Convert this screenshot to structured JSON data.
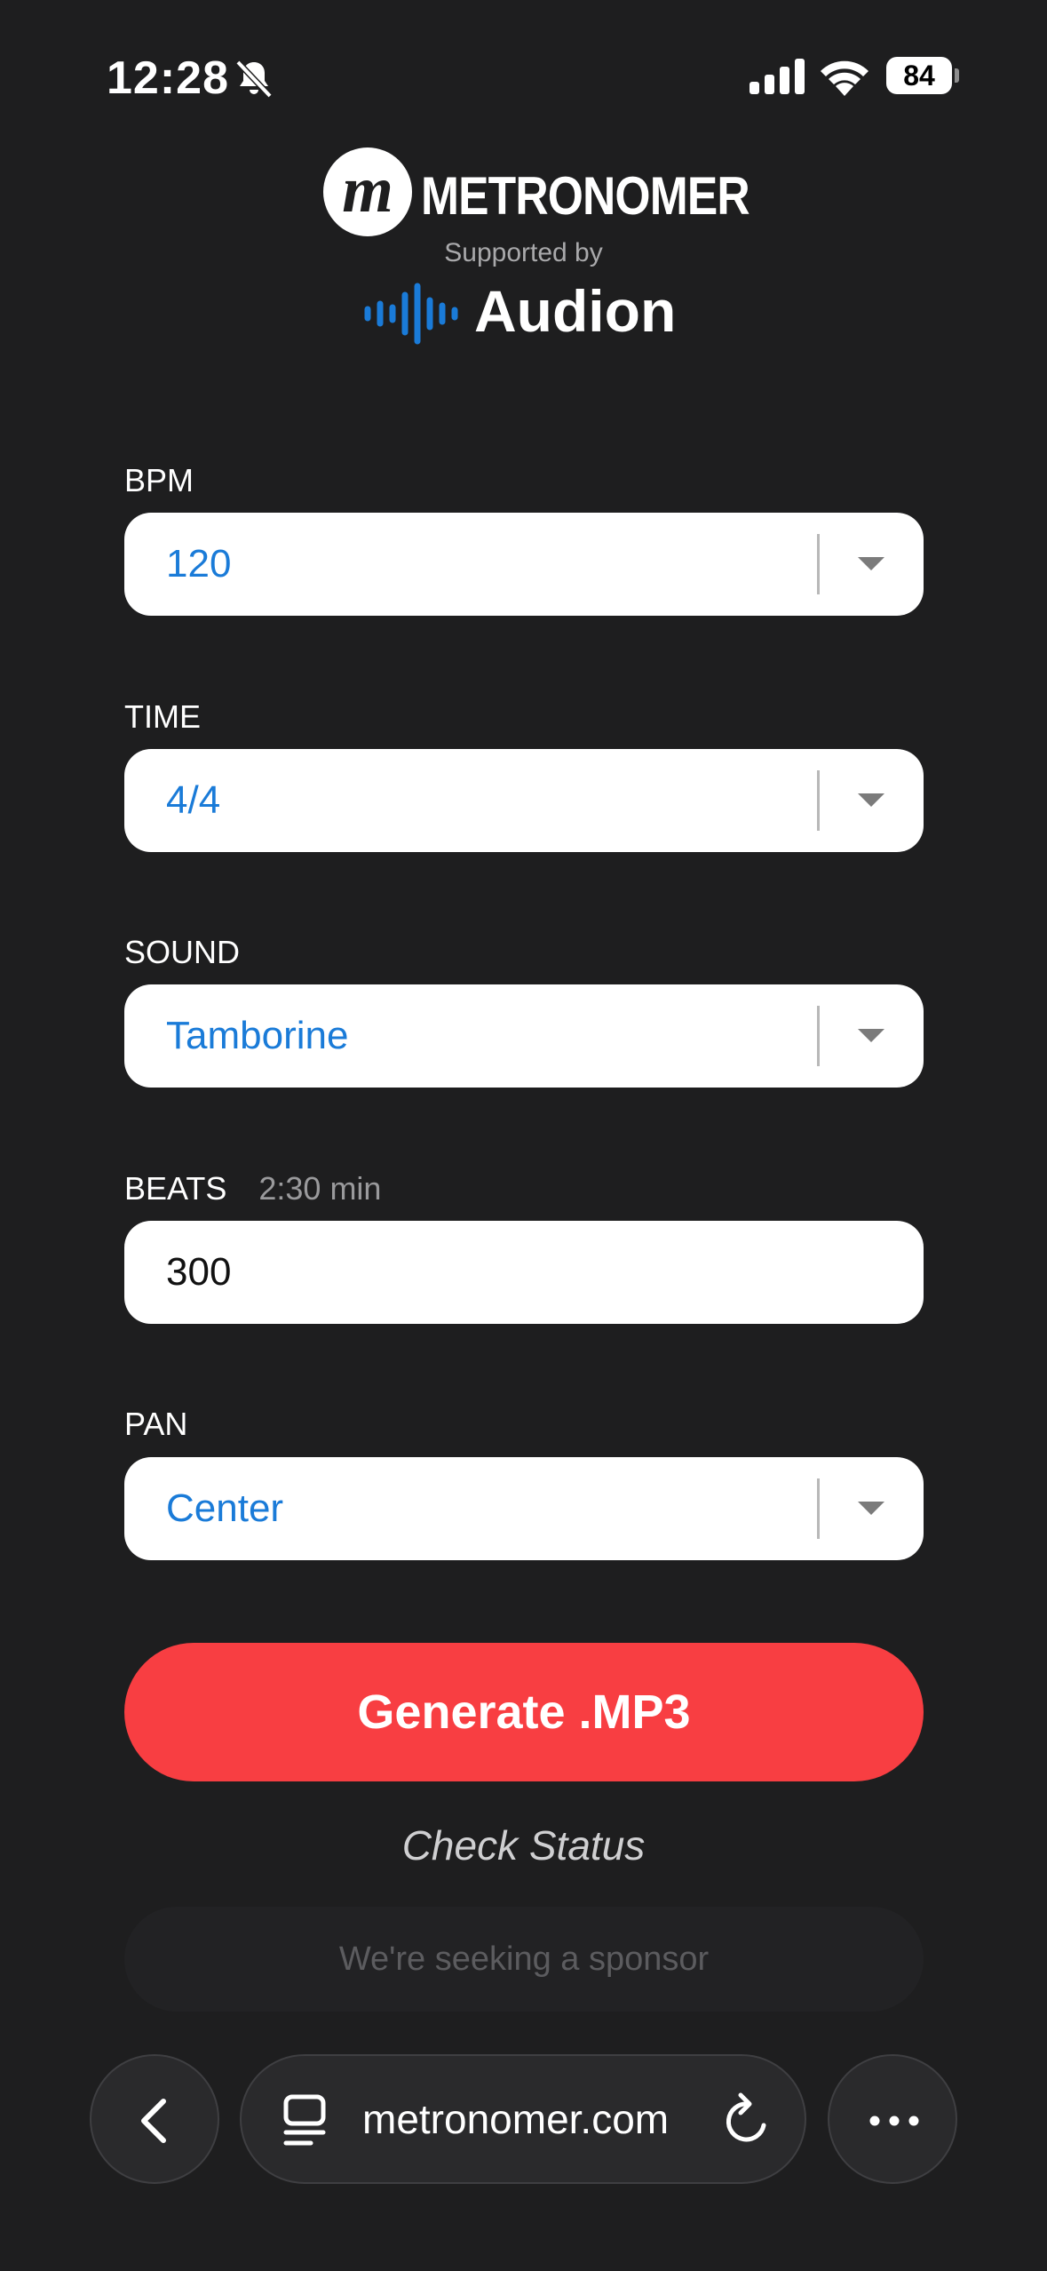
{
  "status_bar": {
    "time": "12:28",
    "battery": "84"
  },
  "brand": {
    "logo_letter": "m",
    "name": "METRONOMER",
    "supported_by": "Supported by",
    "sponsor_name": "Audion"
  },
  "form": {
    "bpm": {
      "label": "BPM",
      "value": "120"
    },
    "time": {
      "label": "TIME",
      "value": "4/4"
    },
    "sound": {
      "label": "SOUND",
      "value": "Tamborine"
    },
    "beats": {
      "label": "BEATS",
      "hint": "2:30 min",
      "value": "300"
    },
    "pan": {
      "label": "PAN",
      "value": "Center"
    }
  },
  "actions": {
    "generate_label": "Generate .MP3",
    "check_status_label": "Check Status",
    "sponsor_text": "We're seeking a sponsor"
  },
  "browser": {
    "url": "metronomer.com"
  },
  "colors": {
    "accent_blue": "#1a7bd8",
    "generate_red": "#f83e42",
    "background": "#1e1e1f"
  }
}
